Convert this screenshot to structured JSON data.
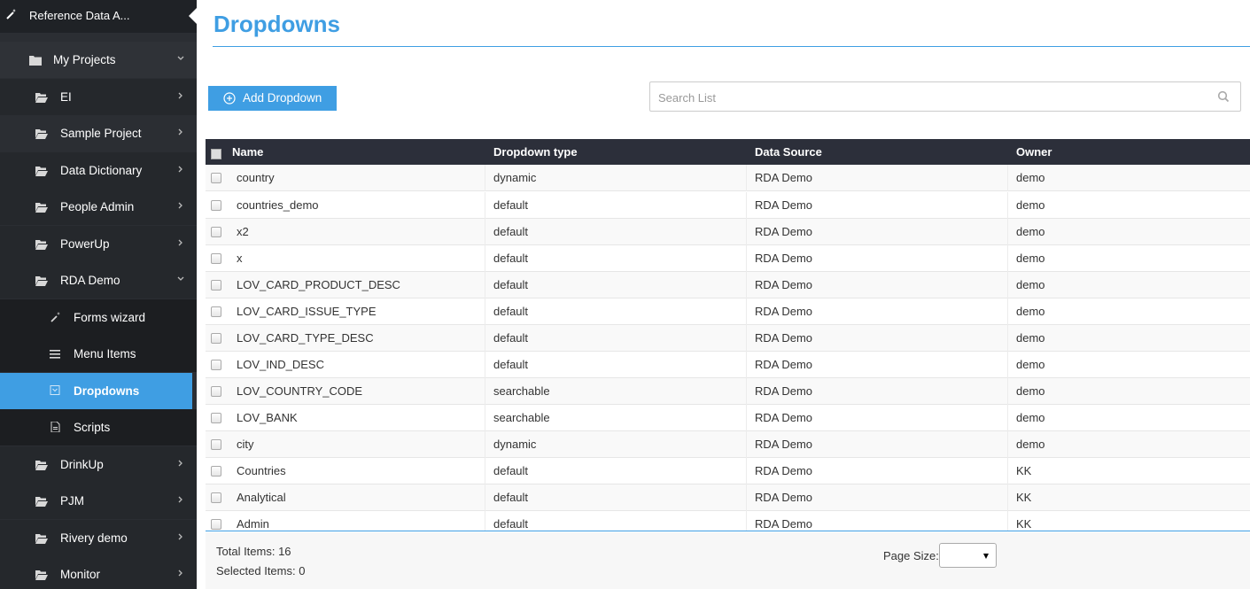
{
  "app": {
    "title": "Reference Data A..."
  },
  "sidebar": {
    "projects_label": "My Projects",
    "items": [
      {
        "label": "EI"
      },
      {
        "label": "Sample Project"
      },
      {
        "label": "Data Dictionary"
      },
      {
        "label": "People Admin"
      },
      {
        "label": "PowerUp"
      },
      {
        "label": "RDA Demo"
      },
      {
        "label": "Forms wizard"
      },
      {
        "label": "Menu Items"
      },
      {
        "label": "Dropdowns"
      },
      {
        "label": "Scripts"
      },
      {
        "label": "DrinkUp"
      },
      {
        "label": "PJM"
      },
      {
        "label": "Rivery demo"
      },
      {
        "label": "Monitor"
      }
    ]
  },
  "page": {
    "title": "Dropdowns"
  },
  "toolbar": {
    "add_label": "Add Dropdown"
  },
  "search": {
    "placeholder": "Search List",
    "value": ""
  },
  "table": {
    "columns": [
      "Name",
      "Dropdown type",
      "Data Source",
      "Owner"
    ],
    "rows": [
      [
        "country",
        "dynamic",
        "RDA Demo",
        "demo"
      ],
      [
        "countries_demo",
        "default",
        "RDA Demo",
        "demo"
      ],
      [
        "x2",
        "default",
        "RDA Demo",
        "demo"
      ],
      [
        "x",
        "default",
        "RDA Demo",
        "demo"
      ],
      [
        "LOV_CARD_PRODUCT_DESC",
        "default",
        "RDA Demo",
        "demo"
      ],
      [
        "LOV_CARD_ISSUE_TYPE",
        "default",
        "RDA Demo",
        "demo"
      ],
      [
        "LOV_CARD_TYPE_DESC",
        "default",
        "RDA Demo",
        "demo"
      ],
      [
        "LOV_IND_DESC",
        "default",
        "RDA Demo",
        "demo"
      ],
      [
        "LOV_COUNTRY_CODE",
        "searchable",
        "RDA Demo",
        "demo"
      ],
      [
        "LOV_BANK",
        "searchable",
        "RDA Demo",
        "demo"
      ],
      [
        "city",
        "dynamic",
        "RDA Demo",
        "demo"
      ],
      [
        "Countries",
        "default",
        "RDA Demo",
        "KK"
      ],
      [
        "Analytical",
        "default",
        "RDA Demo",
        "KK"
      ],
      [
        "Admin",
        "default",
        "RDA Demo",
        "KK"
      ]
    ]
  },
  "footer": {
    "total_items": "Total Items: 16",
    "selected_items": "Selected Items: 0",
    "page_size_label": "Page Size:",
    "page_size_value": ""
  },
  "colors": {
    "accent": "#3f9ee3",
    "sidebar_bg": "#2b2e33",
    "header_bg": "#2c2f3a"
  }
}
